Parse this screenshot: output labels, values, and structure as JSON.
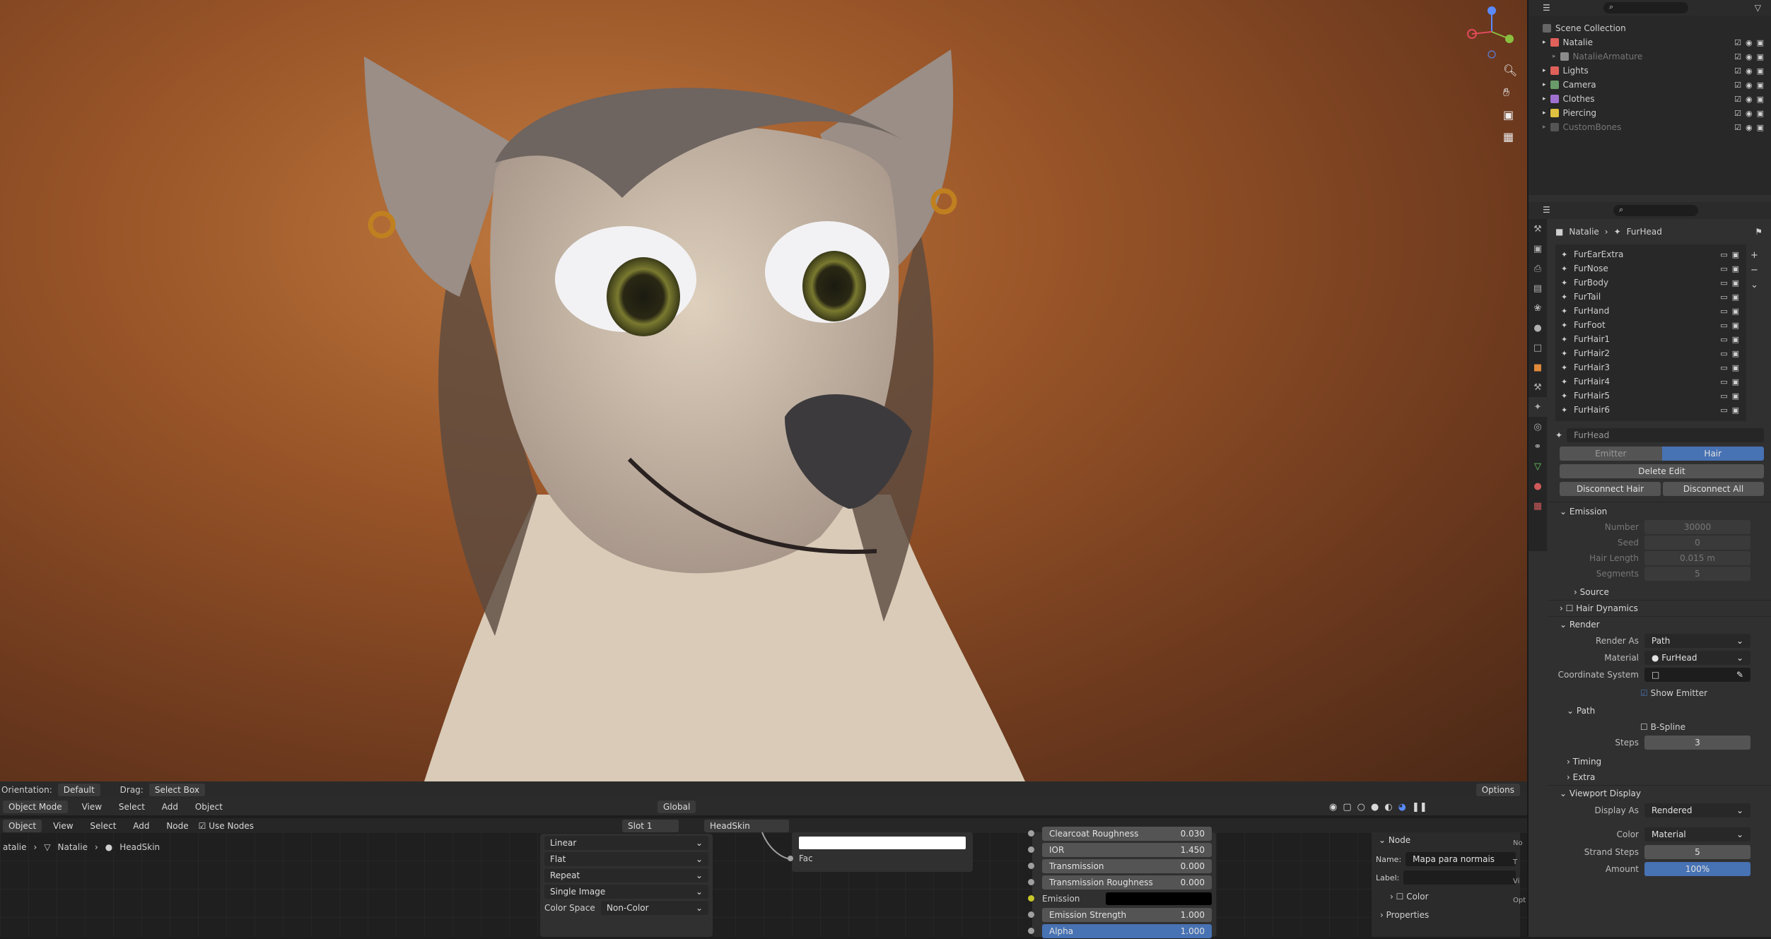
{
  "viewport_header": {
    "orientation_label": "Orientation:",
    "orientation_value": "Default",
    "drag_label": "Drag:",
    "drag_value": "Select Box",
    "options": "Options"
  },
  "view3d_menu": {
    "mode": "Object Mode",
    "items": [
      "View",
      "Select",
      "Add",
      "Object"
    ],
    "transform": "Global"
  },
  "node_header": {
    "editor": "Object",
    "items": [
      "View",
      "Select",
      "Add",
      "Node"
    ],
    "use_nodes": "Use Nodes",
    "slot": "Slot 1",
    "material": "HeadSkin"
  },
  "node_breadcrumb": {
    "obj": "Natalie",
    "mesh": "Natalie",
    "material": "HeadSkin",
    "prefix": "atalie"
  },
  "image_node": {
    "interp": "Linear",
    "projection": "Flat",
    "extension": "Repeat",
    "source": "Single Image",
    "colorspace_label": "Color Space",
    "colorspace_value": "Non-Color"
  },
  "fac_label": "Fac",
  "bsdf_rows": [
    {
      "label": "Clearcoat Roughness",
      "value": "0.030"
    },
    {
      "label": "IOR",
      "value": "1.450"
    },
    {
      "label": "Transmission",
      "value": "0.000"
    },
    {
      "label": "Transmission Roughness",
      "value": "0.000"
    },
    {
      "label": "Emission",
      "value": ""
    },
    {
      "label": "Emission Strength",
      "value": "1.000"
    },
    {
      "label": "Alpha",
      "value": "1.000"
    }
  ],
  "node_sidebar": {
    "section": "Node",
    "name_label": "Name:",
    "name_value": "Mapa para normais",
    "label_label": "Label:",
    "color": "Color",
    "properties": "Properties",
    "tabs": [
      "No",
      "T",
      "Vi",
      "Opt"
    ]
  },
  "outliner": {
    "title": "Scene Collection",
    "items": [
      {
        "name": "Natalie",
        "color": "#e0605a",
        "indent": 1
      },
      {
        "name": "NatalieArmature",
        "color": "#8a8a8a",
        "indent": 2
      },
      {
        "name": "Lights",
        "color": "#e0605a",
        "indent": 1
      },
      {
        "name": "Camera",
        "color": "#6a9a6a",
        "indent": 1
      },
      {
        "name": "Clothes",
        "color": "#a070d0",
        "indent": 1
      },
      {
        "name": "Piercing",
        "color": "#e0c040",
        "indent": 1
      },
      {
        "name": "CustomBones",
        "color": "#555555",
        "indent": 1
      }
    ]
  },
  "properties": {
    "breadcrumb_obj": "Natalie",
    "breadcrumb_ps": "FurHead",
    "systems": [
      "FurEarExtra",
      "FurNose",
      "FurBody",
      "FurTail",
      "FurHand",
      "FurFoot",
      "FurHair1",
      "FurHair2",
      "FurHair3",
      "FurHair4",
      "FurHair5",
      "FurHair6"
    ],
    "ps_name": "FurHead",
    "type_emitter": "Emitter",
    "type_hair": "Hair",
    "delete_edit": "Delete Edit",
    "disconnect_hair": "Disconnect Hair",
    "disconnect_all": "Disconnect All",
    "emission": "Emission",
    "emission_rows": [
      {
        "label": "Number",
        "value": "30000"
      },
      {
        "label": "Seed",
        "value": "0"
      },
      {
        "label": "Hair Length",
        "value": "0.015 m"
      },
      {
        "label": "Segments",
        "value": "5"
      }
    ],
    "source": "Source",
    "hair_dynamics": "Hair Dynamics",
    "render": "Render",
    "render_as_label": "Render As",
    "render_as_value": "Path",
    "material_label": "Material",
    "material_value": "FurHead",
    "coord_label": "Coordinate System",
    "show_emitter": "Show Emitter",
    "path": "Path",
    "bspline": "B-Spline",
    "steps_label": "Steps",
    "steps_value": "3",
    "timing": "Timing",
    "extra": "Extra",
    "viewport_display": "Viewport Display",
    "display_as_label": "Display As",
    "display_as_value": "Rendered",
    "color_label": "Color",
    "color_value": "Material",
    "strand_steps_label": "Strand Steps",
    "strand_steps_value": "5",
    "amount_label": "Amount",
    "amount_value": "100%"
  }
}
